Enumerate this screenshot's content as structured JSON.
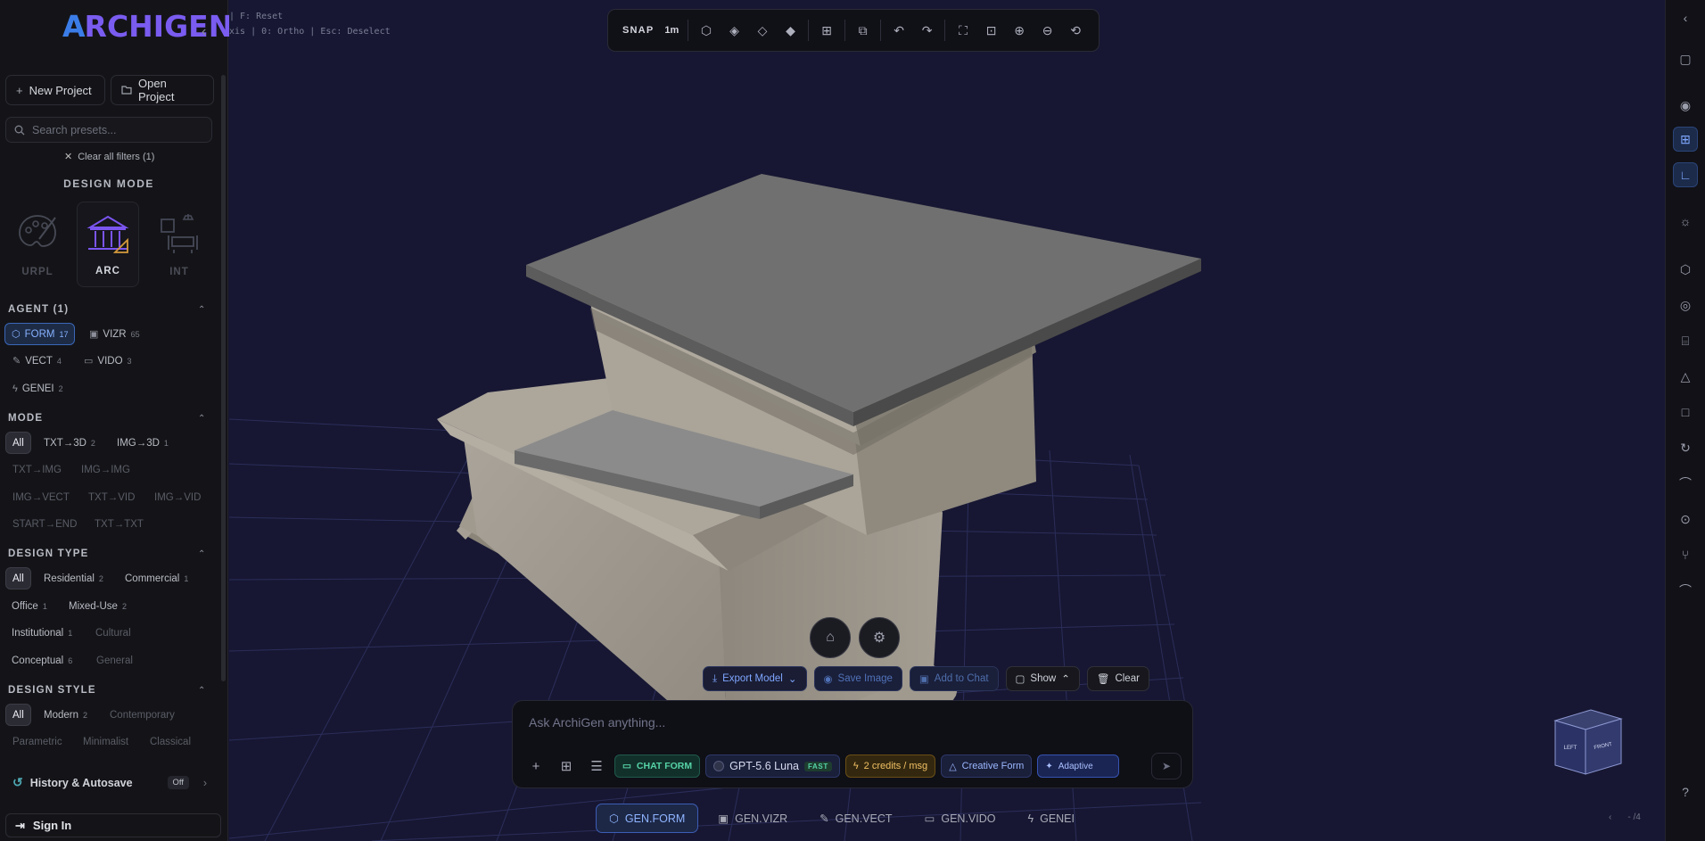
{
  "app": {
    "logo": "ARCHIGEN"
  },
  "header": {
    "new_project": "New Project",
    "open_project": "Open Project"
  },
  "search": {
    "placeholder": "Search presets..."
  },
  "filters": {
    "clear_all": "Clear all filters (1)"
  },
  "design_mode": {
    "title": "DESIGN MODE",
    "cards": [
      {
        "label": "URPL",
        "active": false
      },
      {
        "label": "ARC",
        "active": true
      },
      {
        "label": "INT",
        "active": false
      }
    ]
  },
  "agent": {
    "title": "AGENT (1)",
    "chips": [
      {
        "label": "FORM",
        "count": "17"
      },
      {
        "label": "VIZR",
        "count": "65"
      },
      {
        "label": "VECT",
        "count": "4"
      },
      {
        "label": "VIDO",
        "count": "3"
      },
      {
        "label": "GENEI",
        "count": "2"
      }
    ]
  },
  "mode": {
    "title": "MODE",
    "chips": [
      {
        "label": "All",
        "count": ""
      },
      {
        "label": "TXT→3D",
        "count": "2"
      },
      {
        "label": "IMG→3D",
        "count": "1"
      },
      {
        "label": "TXT→IMG",
        "count": ""
      },
      {
        "label": "IMG→IMG",
        "count": ""
      },
      {
        "label": "IMG→VECT",
        "count": ""
      },
      {
        "label": "TXT→VID",
        "count": ""
      },
      {
        "label": "IMG→VID",
        "count": ""
      },
      {
        "label": "START→END",
        "count": ""
      },
      {
        "label": "TXT→TXT",
        "count": ""
      }
    ]
  },
  "design_type": {
    "title": "DESIGN TYPE",
    "chips": [
      {
        "label": "All",
        "count": ""
      },
      {
        "label": "Residential",
        "count": "2"
      },
      {
        "label": "Commercial",
        "count": "1"
      },
      {
        "label": "Office",
        "count": "1"
      },
      {
        "label": "Mixed-Use",
        "count": "2"
      },
      {
        "label": "Institutional",
        "count": "1"
      },
      {
        "label": "Cultural",
        "count": ""
      },
      {
        "label": "Conceptual",
        "count": "6"
      },
      {
        "label": "General",
        "count": ""
      }
    ]
  },
  "design_style": {
    "title": "DESIGN STYLE",
    "chips": [
      {
        "label": "All",
        "count": ""
      },
      {
        "label": "Modern",
        "count": "2"
      },
      {
        "label": "Contemporary",
        "count": ""
      },
      {
        "label": "Parametric",
        "count": ""
      },
      {
        "label": "Minimalist",
        "count": ""
      },
      {
        "label": "Classical",
        "count": ""
      }
    ]
  },
  "history": {
    "label": "History & Autosave",
    "state": "Off"
  },
  "sign_in": "Sign In",
  "hints": {
    "line1": "| F: Reset",
    "line2": "xis | 0: Ortho | Esc: Deselect"
  },
  "toolbar": {
    "snap": "SNAP",
    "grid": "1m"
  },
  "actions": {
    "export": "Export Model",
    "save_image": "Save Image",
    "add_to_chat": "Add to Chat",
    "show": "Show",
    "clear": "Clear"
  },
  "chat": {
    "placeholder": "Ask ArchiGen anything...",
    "mode": "CHAT FORM",
    "model": "GPT-5.6 Luna",
    "model_badge": "FAST",
    "credits": "2 credits / msg",
    "creative": "Creative Form",
    "adaptive": "Adaptive"
  },
  "bottom_tabs": [
    {
      "label": "GEN.FORM",
      "active": true
    },
    {
      "label": "GEN.VIZR",
      "active": false
    },
    {
      "label": "GEN.VECT",
      "active": false
    },
    {
      "label": "GEN.VIDO",
      "active": false
    },
    {
      "label": "GENEI",
      "active": false
    }
  ],
  "view_cube": {
    "left": "LEFT",
    "front": "FRONT"
  },
  "page_indicator": "- /4",
  "colors": {
    "accent": "#3b7de8",
    "brand_purple": "#7a5cf0",
    "viewport_bg": "#171733",
    "model": "#9e978c",
    "roof": "#6f6f6f"
  }
}
